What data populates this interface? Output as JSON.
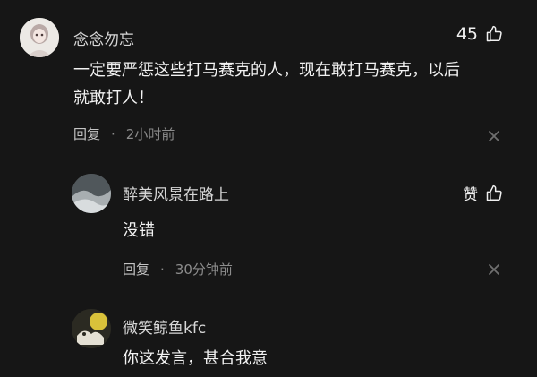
{
  "comments": [
    {
      "username": "念念勿忘",
      "like_count": "45",
      "text_lines": [
        "一定要严惩这些打马赛克的人，现在敢打马赛克，以后",
        "就敢打人！"
      ],
      "reply_label": "回复",
      "separator": "·",
      "time": "2小时前"
    },
    {
      "username": "醉美风景在路上",
      "like_label": "赞",
      "text_lines": [
        "没错"
      ],
      "reply_label": "回复",
      "separator": "·",
      "time": "30分钟前"
    },
    {
      "username": "微笑鲸鱼kfc",
      "text_lines": [
        "你这发言，甚合我意"
      ]
    }
  ],
  "icons": {
    "like": "thumbs-up-icon",
    "close": "close-icon"
  },
  "colors": {
    "background": "#161616",
    "text_primary": "#f2f2f2",
    "text_secondary": "#8c8c8c"
  }
}
